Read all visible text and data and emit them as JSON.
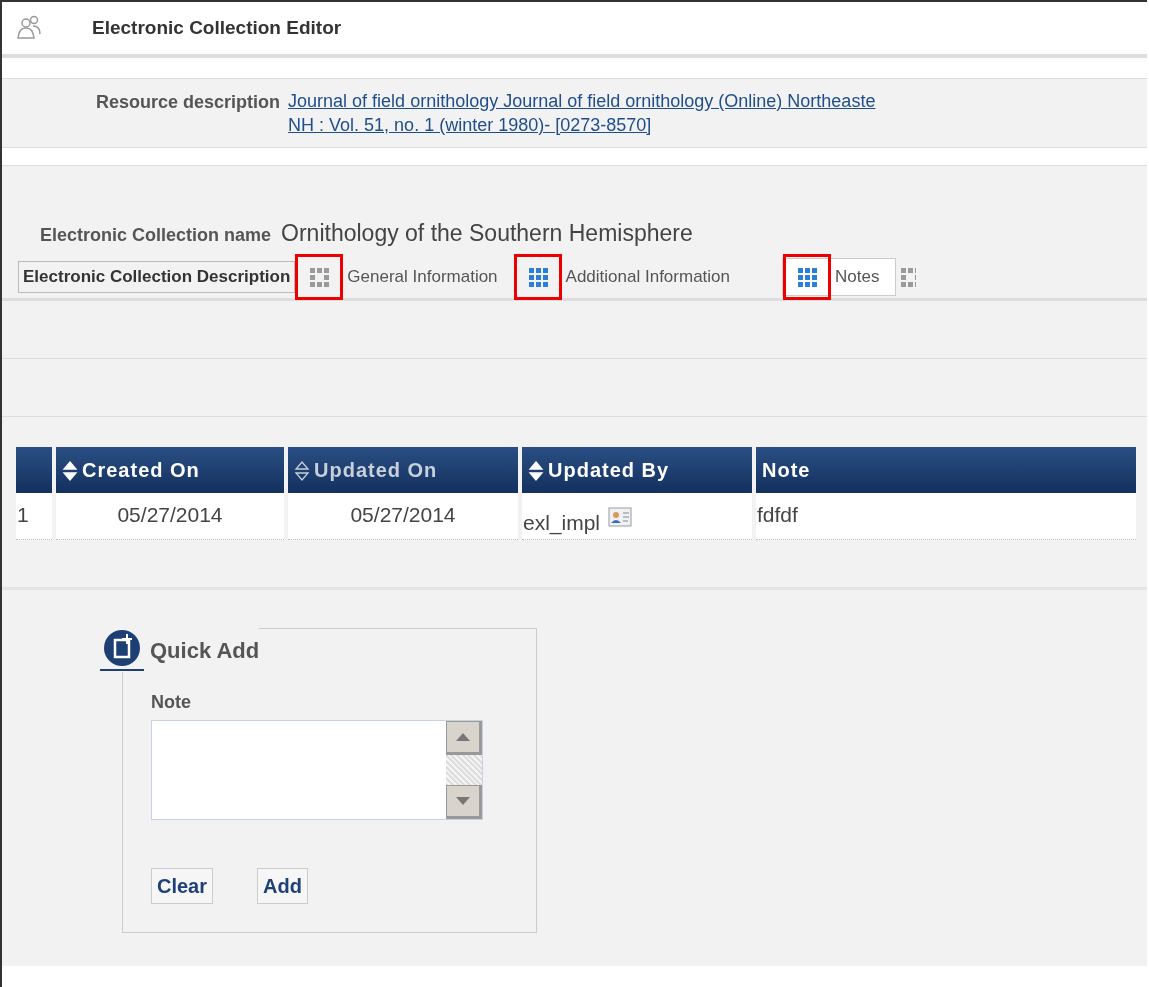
{
  "header": {
    "title": "Electronic Collection Editor"
  },
  "resource": {
    "label": "Resource description",
    "link_lines": [
      "Journal of field ornithology Journal of field ornithology (Online) Northeaste",
      "NH : Vol. 51, no. 1 (winter 1980)- [0273-8570]"
    ]
  },
  "collection": {
    "label": "Electronic Collection name",
    "value": "Ornithology of the Southern Hemisphere"
  },
  "tabs": [
    {
      "label": "Electronic Collection Description",
      "kind": "text",
      "selected": false
    },
    {
      "label": "General Information",
      "kind": "icon",
      "icon_active": false,
      "selected": false,
      "highlighted": true
    },
    {
      "label": "Additional Information",
      "kind": "icon",
      "icon_active": true,
      "selected": false,
      "highlighted": true
    },
    {
      "label": "Notes",
      "kind": "icon",
      "icon_active": true,
      "selected": true,
      "highlighted": true
    },
    {
      "kind": "cut"
    }
  ],
  "table": {
    "columns": [
      {
        "kind": "blank"
      },
      {
        "label": "Created On",
        "kind": "sortable",
        "sorted": false
      },
      {
        "label": "Updated On",
        "kind": "sortable",
        "sorted": true
      },
      {
        "label": "Updated By",
        "kind": "sortable",
        "sorted": false
      },
      {
        "label": "Note",
        "kind": "plain"
      }
    ],
    "rows": [
      {
        "cells": [
          "1",
          "05/27/2014",
          "05/27/2014",
          "exl_impl",
          "fdfdf"
        ]
      }
    ]
  },
  "quick_add": {
    "title": "Quick Add",
    "field_label": "Note",
    "buttons": [
      "Clear",
      "Add"
    ]
  }
}
